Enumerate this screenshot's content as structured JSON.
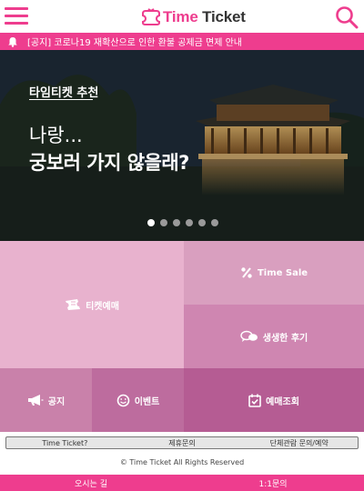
{
  "header": {
    "logo_time": "Time",
    "logo_ticket": "Ticket",
    "menu_icon": "hamburger-menu-icon",
    "search_icon": "search-icon"
  },
  "notice": {
    "icon": "bell-icon",
    "text": "[공지] 코로나19 재확산으로 인한 환불 공제금 면제 안내"
  },
  "hero": {
    "tag": "타임티켓 추천",
    "line1": "나랑...",
    "line2": "궁보러 가지 않을래?",
    "slide_count": 6,
    "active_slide": 1
  },
  "tiles": {
    "ticket": {
      "label": "티켓예매",
      "icon": "ticket-icon"
    },
    "time_sale": {
      "label": "Time Sale",
      "icon": "percent-icon"
    },
    "review": {
      "label": "생생한 후기",
      "icon": "speech-bubble-icon"
    },
    "notice": {
      "label": "공지",
      "icon": "megaphone-icon"
    },
    "event": {
      "label": "이벤트",
      "icon": "smiley-icon"
    },
    "reservation": {
      "label": "예매조회",
      "icon": "calendar-check-icon"
    }
  },
  "footer": {
    "links": [
      "Time Ticket?",
      "제휴문의",
      "단체관람 문의/예약"
    ],
    "copyright": "© Time Ticket All Rights Reserved",
    "bottom_links": [
      "오시는 길",
      "1:1문의"
    ]
  },
  "colors": {
    "brand": "#ee3d8e",
    "tile_ticket": "#e8b2ce",
    "tile_time_sale": "#d99fbf",
    "tile_review": "#cf86b1",
    "tile_notice": "#c981aa",
    "tile_event": "#bd6c9e",
    "tile_reservation": "#b55c93"
  }
}
